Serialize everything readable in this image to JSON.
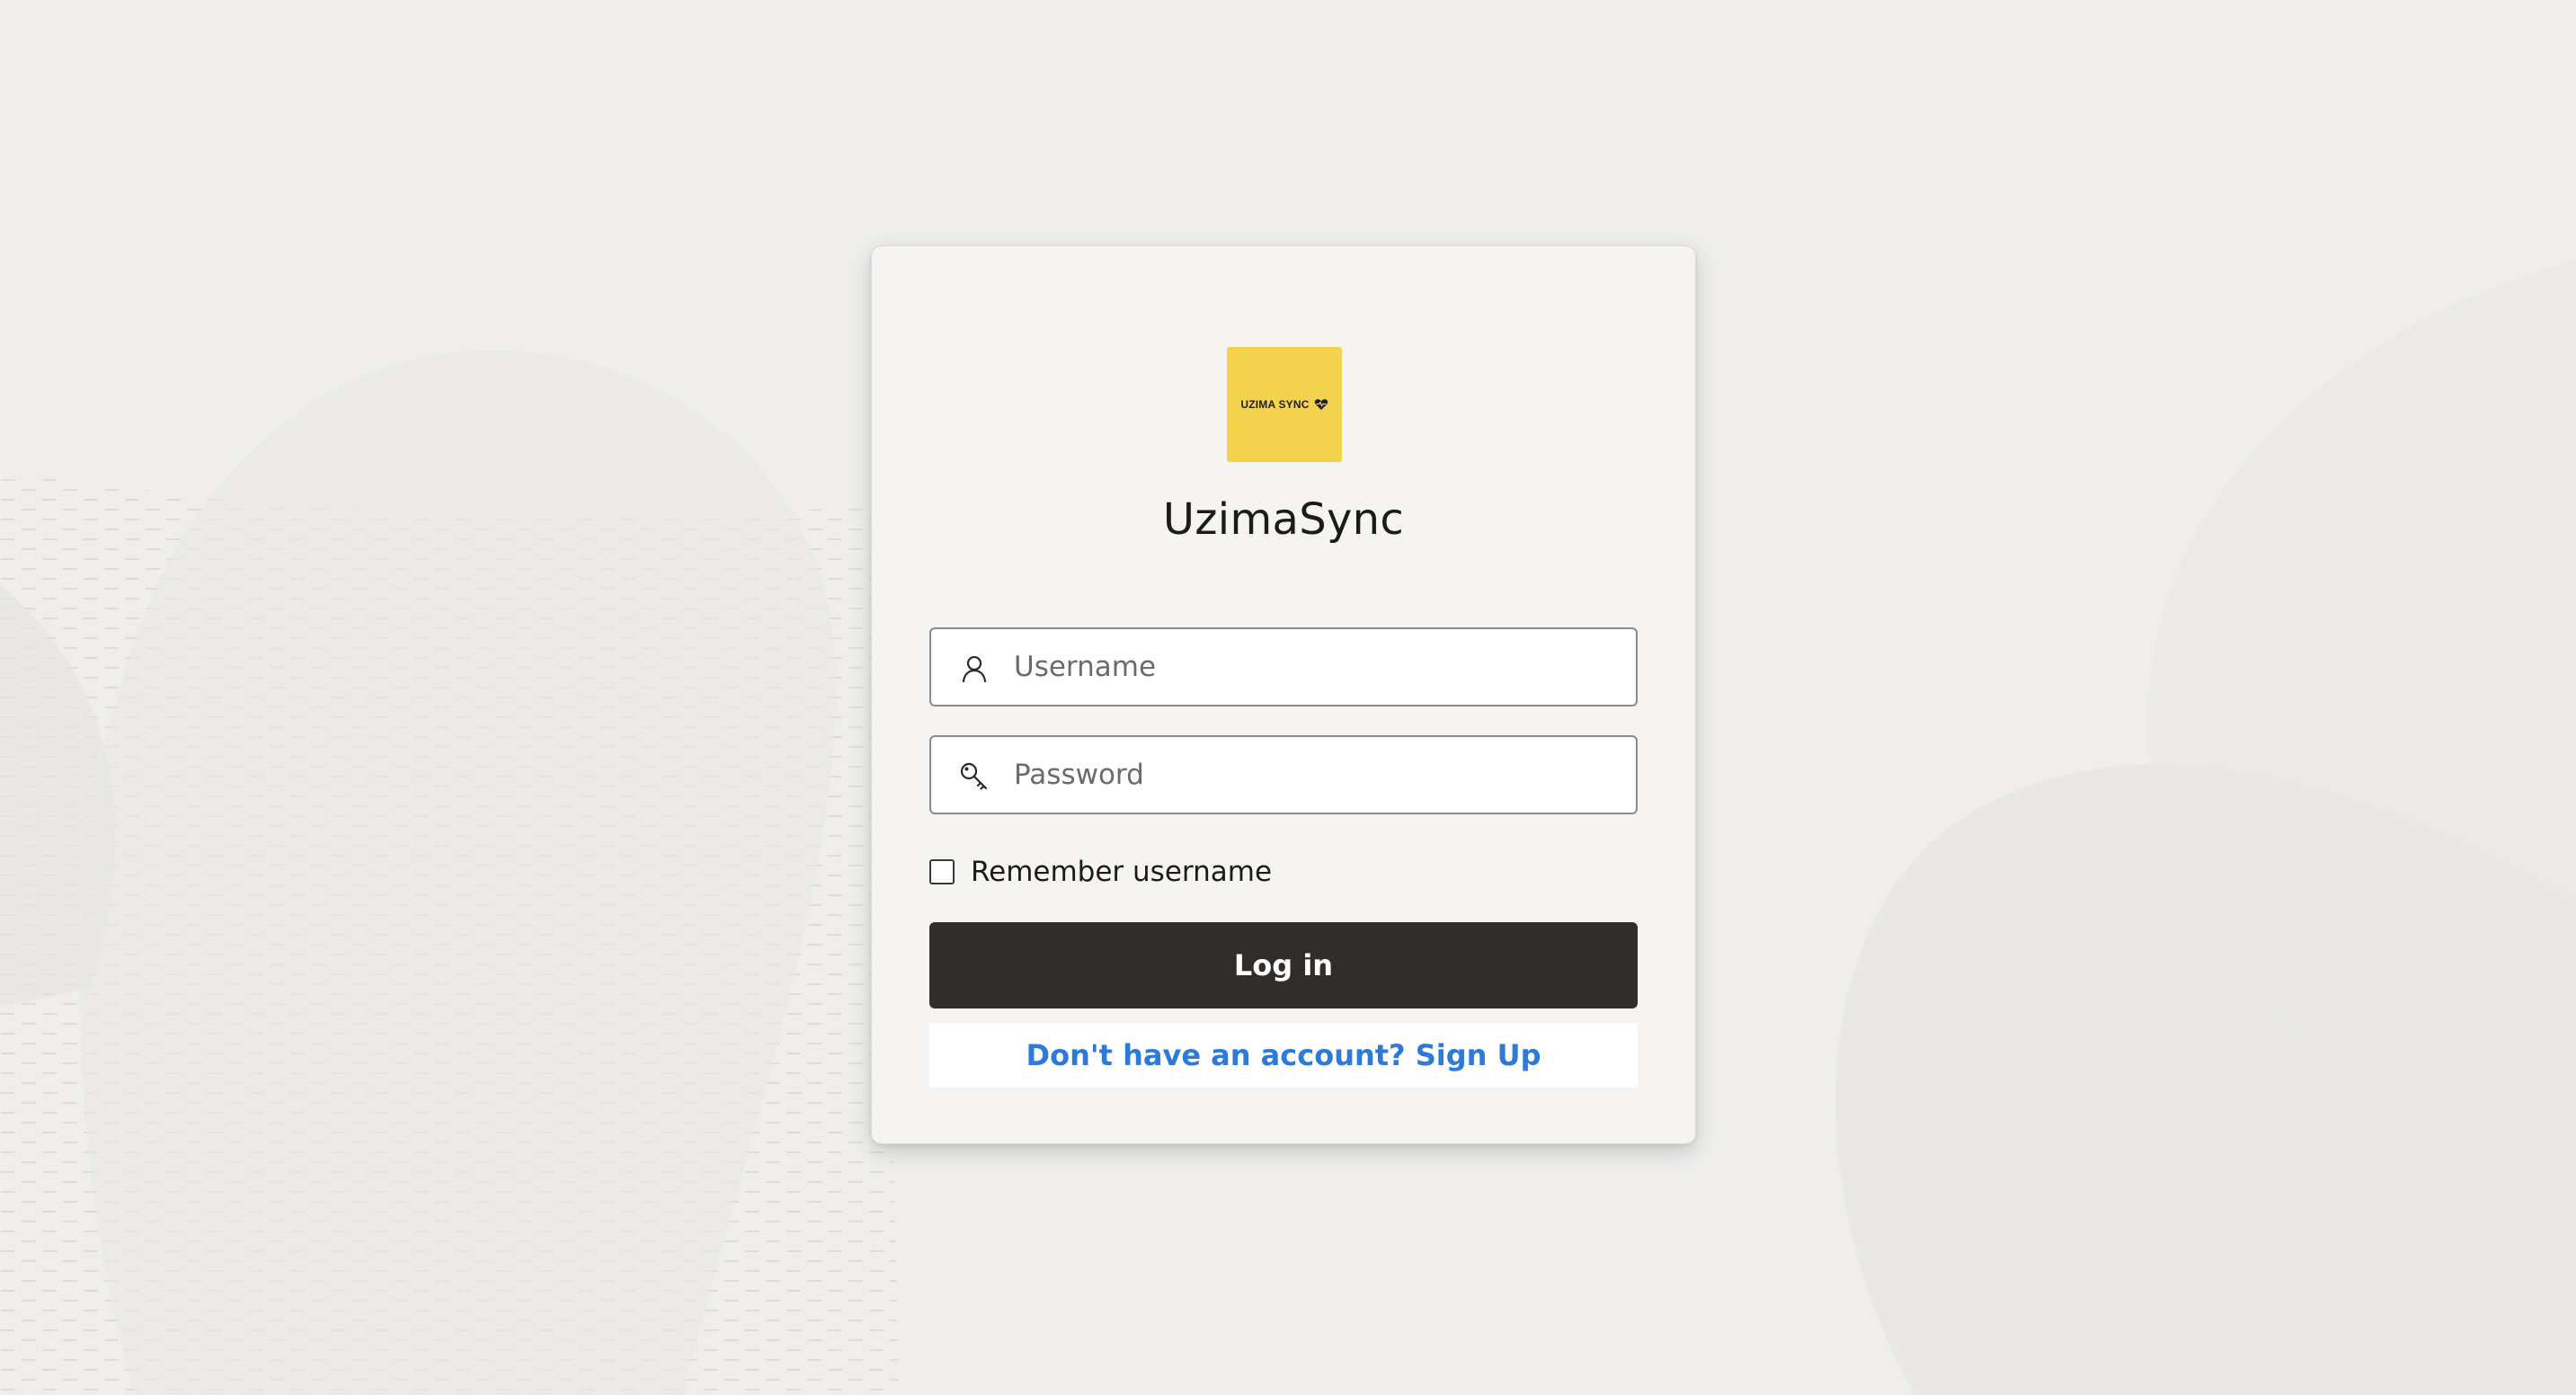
{
  "colors": {
    "page_background": "#efeeec",
    "card_background": "#f5f4f2",
    "logo_background": "#f3d24e",
    "login_button": "#312d2a",
    "link": "#2e7ad8"
  },
  "logo": {
    "text": "UZIMA SYNC",
    "icon": "heart-icon"
  },
  "app": {
    "title": "UzimaSync"
  },
  "form": {
    "username": {
      "icon": "user-icon",
      "placeholder": "Username",
      "value": ""
    },
    "password": {
      "icon": "key-icon",
      "placeholder": "Password",
      "value": ""
    },
    "remember": {
      "label": "Remember username",
      "checked": false
    },
    "login_label": "Log in",
    "signup_label": "Don't have an account? Sign Up"
  }
}
